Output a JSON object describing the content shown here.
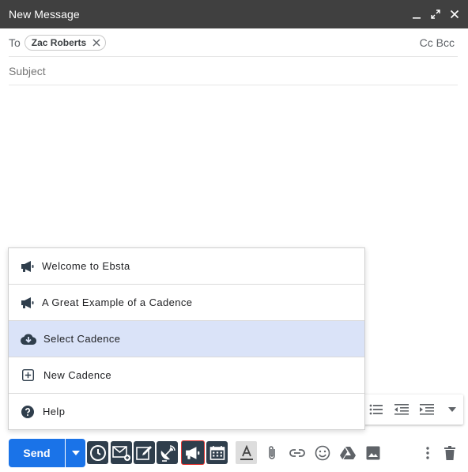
{
  "window": {
    "title": "New Message",
    "controls": {
      "minimize": "minimize-icon",
      "popout": "popout-icon",
      "close": "close-icon"
    }
  },
  "recipients": {
    "to_label": "To",
    "chips": [
      {
        "name": "Zac Roberts"
      }
    ],
    "cc_label": "Cc",
    "bcc_label": "Bcc"
  },
  "subject": {
    "placeholder": "Subject",
    "value": ""
  },
  "cadence_menu": {
    "items": [
      {
        "label": "Welcome to Ebsta",
        "icon": "megaphone-icon",
        "selected": false
      },
      {
        "label": "A Great Example of a Cadence",
        "icon": "megaphone-icon",
        "selected": false
      },
      {
        "label": "Select Cadence",
        "icon": "cloud-download-icon",
        "selected": true
      },
      {
        "label": "New Cadence",
        "icon": "plus-box-icon",
        "selected": false
      },
      {
        "label": "Help",
        "icon": "help-circle-icon",
        "selected": false
      }
    ]
  },
  "formatting": {
    "icons": [
      "bulleted-list-icon",
      "indent-less-icon",
      "indent-more-icon",
      "more-formatting-icon"
    ]
  },
  "actions": {
    "send_label": "Send",
    "colors": {
      "send": "#1a73e8",
      "ebsta_dark": "#2f3e4c",
      "highlight_outline": "#e53935",
      "menu_selected": "#dae3f8"
    }
  }
}
